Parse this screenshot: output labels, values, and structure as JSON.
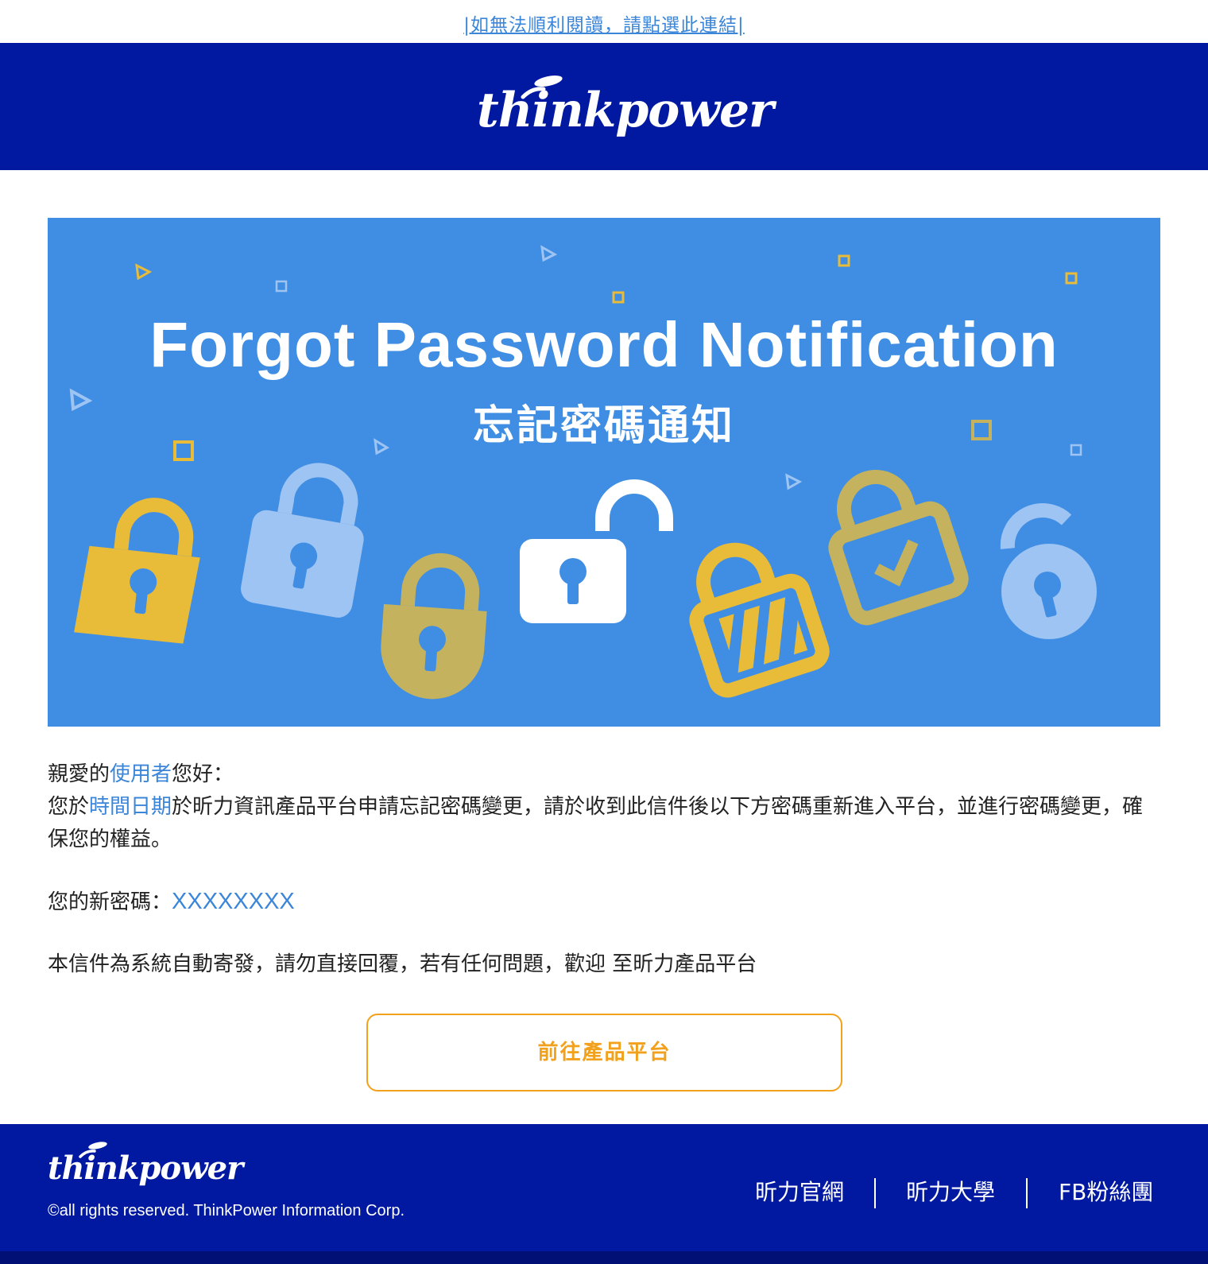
{
  "top_bar": {
    "link_text": "|如無法順利閱讀，請點選此連結|"
  },
  "header": {
    "logo_text": "thinkpower"
  },
  "banner": {
    "title": "Forgot Password Notification",
    "subtitle": "忘記密碼通知"
  },
  "greeting": {
    "prefix": "親愛的",
    "user": "使用者",
    "suffix": "您好："
  },
  "body": {
    "line1_prefix": "您於",
    "line1_date": "時間日期",
    "line1_rest": "於昕力資訊產品平台申請忘記密碼變更，請於收到此信件後以下方密碼重新進入平台，並進行密碼變更，確保您的權益。"
  },
  "password": {
    "label": "您的新密碼：",
    "value": "XXXXXXXX"
  },
  "notice": {
    "text": "本信件為系統自動寄發，請勿直接回覆，若有任何問題，歡迎 至昕力產品平台"
  },
  "cta": {
    "label": "前往產品平台"
  },
  "footer": {
    "logo_text": "thinkpower",
    "copyright": "©all rights reserved. ThinkPower Information Corp.",
    "links": [
      "昕力官網",
      "昕力大學",
      "FB粉絲團"
    ]
  },
  "colors": {
    "header_bg": "#0019a0",
    "banner_bg": "#408ee3",
    "accent_blue": "#3b86d8",
    "cta_orange": "#f2a11d",
    "lock_yellow": "#e8bb39",
    "lock_olive": "#c4b25e",
    "lock_light_blue": "#9ec4f3"
  }
}
